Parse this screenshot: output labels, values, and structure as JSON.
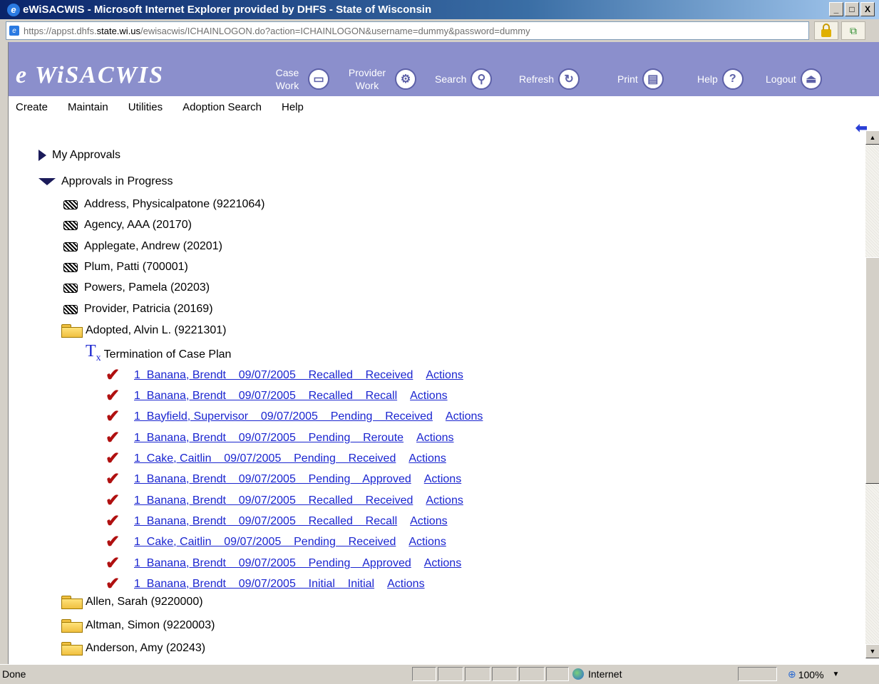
{
  "window": {
    "title": "eWiSACWIS - Microsoft Internet Explorer provided by DHFS - State of Wisconsin",
    "min_label": "_",
    "max_label": "□",
    "close_label": "X"
  },
  "address": {
    "url_prefix": "https://appst.dhfs.",
    "url_domain": "state.wi.us",
    "url_suffix": "/ewisacwis/ICHAINLOGON.do?action=ICHAINLOGON&username=dummy&password=dummy"
  },
  "app": {
    "logo": "e WiSACWIS",
    "nav": [
      {
        "label": "Case Work",
        "icon": "case-work-icon",
        "glyph": "▭"
      },
      {
        "label": "Provider Work",
        "icon": "provider-work-icon",
        "glyph": "⚙"
      },
      {
        "label": "Search",
        "icon": "search-icon",
        "glyph": "⚲"
      },
      {
        "label": "Refresh",
        "icon": "refresh-icon",
        "glyph": "↻"
      },
      {
        "label": "Print",
        "icon": "print-icon",
        "glyph": "▤"
      },
      {
        "label": "Help",
        "icon": "help-icon",
        "glyph": "?"
      },
      {
        "label": "Logout",
        "icon": "logout-icon",
        "glyph": "⏏"
      }
    ],
    "menu": [
      "Create",
      "Maintain",
      "Utilities",
      "Adoption Search",
      "Help"
    ]
  },
  "tree": {
    "my_approvals": "My Approvals",
    "approvals_in_progress": "Approvals in Progress",
    "workers": [
      "Address, Physicalpatone   (9221064)",
      "Agency, AAA   (20170)",
      "Applegate, Andrew   (20201)",
      "Plum, Patti   (700001)",
      "Powers, Pamela   (20203)",
      "Provider, Patricia   (20169)"
    ],
    "open_case": "Adopted, Alvin L.   (9221301)",
    "plan": "Termination of Case Plan",
    "approval_rows": [
      {
        "text": "1  Banana, Brendt    09/07/2005    Recalled    Received",
        "action": "Actions"
      },
      {
        "text": "1  Banana, Brendt    09/07/2005    Recalled    Recall",
        "action": "Actions"
      },
      {
        "text": "1  Bayfield, Supervisor    09/07/2005    Pending    Received",
        "action": "Actions"
      },
      {
        "text": "1  Banana, Brendt    09/07/2005    Pending    Reroute",
        "action": "Actions"
      },
      {
        "text": "1  Cake, Caitlin    09/07/2005    Pending    Received",
        "action": "Actions"
      },
      {
        "text": "1  Banana, Brendt    09/07/2005    Pending    Approved",
        "action": "Actions"
      },
      {
        "text": "1  Banana, Brendt    09/07/2005    Recalled    Received",
        "action": "Actions"
      },
      {
        "text": "1  Banana, Brendt    09/07/2005    Recalled    Recall",
        "action": "Actions"
      },
      {
        "text": "1  Cake, Caitlin    09/07/2005    Pending    Received",
        "action": "Actions"
      },
      {
        "text": "1  Banana, Brendt    09/07/2005    Pending    Approved",
        "action": "Actions"
      },
      {
        "text": "1  Banana, Brendt    09/07/2005    Initial    Initial",
        "action": "Actions"
      }
    ],
    "other_cases": [
      "Allen, Sarah   (9220000)",
      "Altman, Simon   (9220003)",
      "Anderson, Amy   (20243)"
    ]
  },
  "status": {
    "text": "Done",
    "zone": "Internet",
    "zoom": "100%"
  }
}
